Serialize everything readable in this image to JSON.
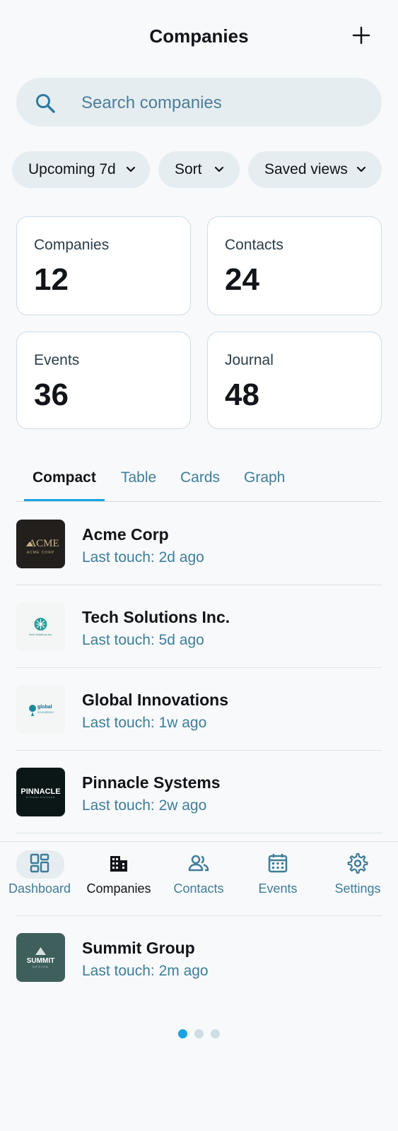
{
  "header": {
    "title": "Companies",
    "add_icon": "plus-icon"
  },
  "search": {
    "placeholder": "Search companies",
    "icon": "search-icon"
  },
  "filters": [
    {
      "label": "Upcoming 7d"
    },
    {
      "label": "Sort"
    },
    {
      "label": "Saved views"
    }
  ],
  "stats": [
    {
      "label": "Companies",
      "value": "12"
    },
    {
      "label": "Contacts",
      "value": "24"
    },
    {
      "label": "Events",
      "value": "36"
    },
    {
      "label": "Journal",
      "value": "48"
    }
  ],
  "tabs": [
    {
      "label": "Compact",
      "active": true
    },
    {
      "label": "Table"
    },
    {
      "label": "Cards"
    },
    {
      "label": "Graph"
    }
  ],
  "companies": [
    {
      "name": "Acme Corp",
      "last_touch": "Last touch: 2d ago",
      "logo_text": "ACME",
      "logo_sub": "ACME CORP"
    },
    {
      "name": "Tech Solutions Inc.",
      "last_touch": "Last touch: 5d ago",
      "logo_text": "Tech Solutions Inc."
    },
    {
      "name": "Global Innovations",
      "last_touch": "Last touch: 1w ago",
      "logo_text": "global",
      "logo_sub": "innovations"
    },
    {
      "name": "Pinnacle Systems",
      "last_touch": "Last touch: 2w ago",
      "logo_text": "PINNACLE",
      "logo_sub": "SYSTEMS PLATFORM"
    },
    {
      "name": "Summit Group",
      "last_touch": "Last touch: 2m ago",
      "logo_text": "SUMMIT",
      "logo_sub": "DESIGN"
    }
  ],
  "bottom_nav": [
    {
      "label": "Dashboard",
      "icon": "dashboard-icon"
    },
    {
      "label": "Companies",
      "icon": "building-icon",
      "active": true
    },
    {
      "label": "Contacts",
      "icon": "people-icon"
    },
    {
      "label": "Events",
      "icon": "calendar-icon"
    },
    {
      "label": "Settings",
      "icon": "gear-icon"
    }
  ],
  "pagination": {
    "total": 3,
    "current": 1
  },
  "colors": {
    "accent": "#1aa3e2",
    "link": "#3f7d99",
    "chip_bg": "#e6edf0"
  }
}
